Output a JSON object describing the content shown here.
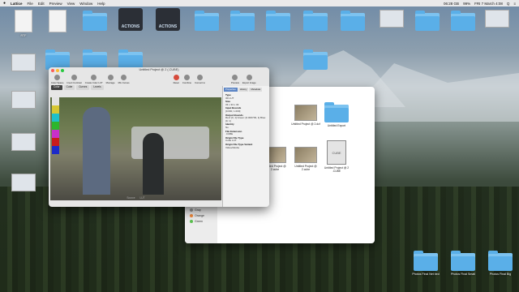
{
  "menubar": {
    "app": "Lattice",
    "items": [
      "File",
      "Edit",
      "Preview",
      "View",
      "Window",
      "Help"
    ],
    "status": [
      "06:28 GB",
      "99%",
      "FRI 7 March 4:08",
      "Q",
      "≡"
    ]
  },
  "desktop": {
    "icons": [
      {
        "label": "RTF",
        "kind": "doc"
      },
      {
        "label": "",
        "kind": "doc"
      },
      {
        "label": "",
        "kind": "folder"
      },
      {
        "label": "ACTIONS",
        "kind": "actions"
      },
      {
        "label": "ACTIONS",
        "kind": "actions"
      },
      {
        "label": "",
        "kind": "folder"
      },
      {
        "label": "",
        "kind": "folder"
      },
      {
        "label": "",
        "kind": "folder"
      },
      {
        "label": "",
        "kind": "folder"
      },
      {
        "label": "",
        "kind": "folder"
      },
      {
        "label": "",
        "kind": "shot"
      },
      {
        "label": "",
        "kind": "folder"
      },
      {
        "label": "",
        "kind": "folder"
      },
      {
        "label": "",
        "kind": "shot"
      },
      {
        "label": "",
        "kind": "folder"
      },
      {
        "label": "",
        "kind": "folder"
      },
      {
        "label": "",
        "kind": "folder"
      },
      {
        "label": "",
        "kind": "shot"
      },
      {
        "label": "",
        "kind": "shot"
      },
      {
        "label": "",
        "kind": "folder"
      },
      {
        "label": "",
        "kind": "shot"
      },
      {
        "label": "",
        "kind": "shot"
      },
      {
        "label": "Photos Final Net bed",
        "kind": "folder"
      },
      {
        "label": "Photos Final Small",
        "kind": "folder"
      },
      {
        "label": "Photos Final Big",
        "kind": "folder"
      }
    ]
  },
  "finder": {
    "tags": [
      {
        "label": "Purple",
        "color": "#b06ad1"
      },
      {
        "label": "Gray",
        "color": "#9a9a9a"
      },
      {
        "label": "Orange",
        "color": "#f0883a"
      },
      {
        "label": "Green",
        "color": "#5bbf4f"
      }
    ],
    "files": [
      {
        "label": "Untitled Project @ 2.dcf",
        "kind": "thumb"
      },
      {
        "label": "Untitled Export",
        "kind": "folder"
      },
      {
        "label": "Untitled Project @ 2.cube",
        "kind": "thumb"
      },
      {
        "label": "Untitled Project @ 2.cube",
        "kind": "thumb"
      },
      {
        "label": "Untitled Project @ 2 .CUBE",
        "kind": "cube"
      }
    ]
  },
  "lattice": {
    "title": "Untitled Project @ 2 (.CUBE)",
    "tools": [
      "Color Space",
      "Invert Contrast",
      "Create Color LUT",
      "Montage",
      "Mix Curves",
      "Reset",
      "Combine",
      "Convert to",
      "Preview",
      "Export Image"
    ],
    "tabs": [
      "Color",
      "Cube",
      "Curves",
      "Levels"
    ],
    "viewer_labels": [
      "Source",
      "LUT"
    ],
    "color_bars": [
      "#e3e3e3",
      "#d6c733",
      "#1fc0c9",
      "#2db62d",
      "#c830c9",
      "#c91c1c",
      "#1d2bc9"
    ],
    "inspector": {
      "tabs": [
        "Properties",
        "History",
        "Metadata"
      ],
      "props": [
        {
          "k": "Type",
          "v": "3D LUT"
        },
        {
          "k": "Size",
          "v": "33 x 33 x 33"
        },
        {
          "k": "Input Bounds",
          "v": "[0.000, 1.000]"
        },
        {
          "k": "Output Bounds",
          "v": "Red: [0, 1]  Green: [0.000709, 1]  Blue: [0, 1]"
        },
        {
          "k": "Identity",
          "v": "No"
        },
        {
          "k": "File Extension",
          "v": ".CUBE"
        },
        {
          "k": "Origin File Type",
          "v": "Cube LUT"
        },
        {
          "k": "Origin File Type Variant",
          "v": "Video/Adobe"
        }
      ]
    }
  }
}
